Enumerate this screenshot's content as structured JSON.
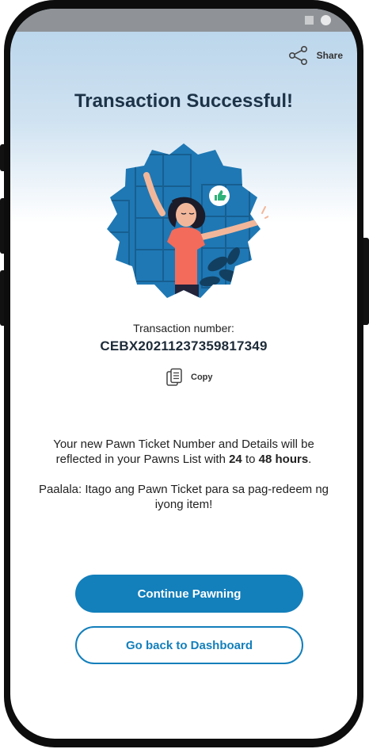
{
  "header": {
    "share_label": "Share",
    "share_icon": "share-icon"
  },
  "title": "Transaction Successful!",
  "illustration": {
    "description_icon": "celebrating-woman-illustration",
    "accent_icon": "thumbs-up-icon"
  },
  "transaction": {
    "label": "Transaction number:",
    "number": "CEBX20211237359817349",
    "copy_label": "Copy",
    "copy_icon": "copy-icon"
  },
  "message": {
    "part1": "Your new Pawn Ticket Number and Details will be reflected in your Pawns List with ",
    "hours_min": "24",
    "part2": " to ",
    "hours_max": "48 hours",
    "part3": "."
  },
  "reminder": "Paalala: Itago ang Pawn Ticket para sa pag-redeem ng iyong item!",
  "buttons": {
    "continue": "Continue Pawning",
    "dashboard": "Go back to Dashboard"
  },
  "colors": {
    "primary": "#137fbb",
    "title": "#1d3347",
    "illustration_blue": "#1f78b4",
    "shirt": "#f26b5b",
    "success_green": "#2fb27a"
  }
}
